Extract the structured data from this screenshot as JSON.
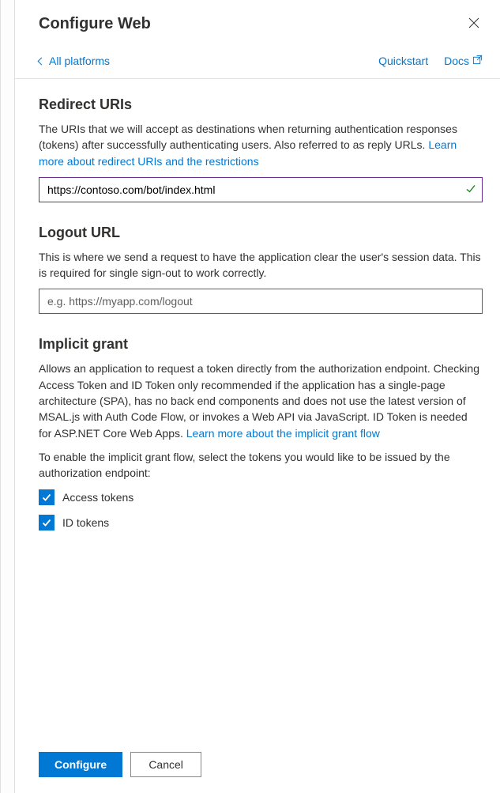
{
  "header": {
    "title": "Configure Web"
  },
  "topbar": {
    "back_label": "All platforms",
    "quickstart_label": "Quickstart",
    "docs_label": "Docs"
  },
  "redirect": {
    "heading": "Redirect URIs",
    "desc_part1": "The URIs that we will accept as destinations when returning authentication responses (tokens) after successfully authenticating users. Also referred to as reply URLs. ",
    "learn_more": "Learn more about redirect URIs and the restrictions",
    "input_value": "https://contoso.com/bot/index.html"
  },
  "logout": {
    "heading": "Logout URL",
    "desc": "This is where we send a request to have the application clear the user's session data. This is required for single sign-out to work correctly.",
    "placeholder": "e.g. https://myapp.com/logout"
  },
  "implicit": {
    "heading": "Implicit grant",
    "desc_part1": "Allows an application to request a token directly from the authorization endpoint. Checking Access Token and ID Token only recommended if the application has a single-page architecture (SPA), has no back end components and does not use the latest version of MSAL.js with Auth Code Flow, or invokes a Web API via JavaScript. ID Token is needed for ASP.NET Core Web Apps. ",
    "learn_more": "Learn more about the implicit grant flow",
    "enable_text": "To enable the implicit grant flow, select the tokens you would like to be issued by the authorization endpoint:",
    "checkbox_access": "Access tokens",
    "checkbox_id": "ID tokens"
  },
  "footer": {
    "configure": "Configure",
    "cancel": "Cancel"
  }
}
